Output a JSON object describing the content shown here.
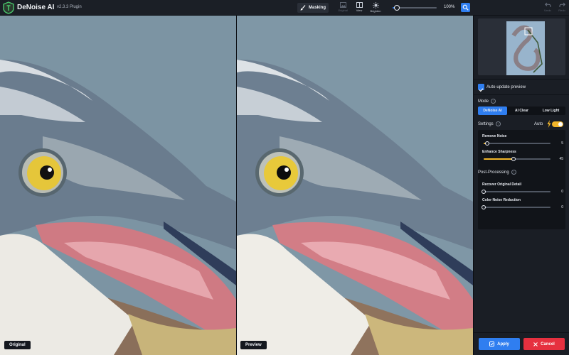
{
  "app": {
    "title": "DeNoise AI",
    "version": "v2.3.3 Plugin"
  },
  "toolbar": {
    "masking_label": "Masking",
    "tools": [
      {
        "label": "Original",
        "icon": "image-icon",
        "enabled": false
      },
      {
        "label": "View",
        "icon": "split-view-icon",
        "enabled": true
      },
      {
        "label": "Brighten",
        "icon": "sun-icon",
        "enabled": true
      }
    ],
    "zoom": {
      "value": 0.1,
      "label": "100%"
    },
    "undo_label": "Undo",
    "redo_label": "Redo"
  },
  "panes": {
    "left_label": "Original",
    "right_label": "Preview"
  },
  "panel": {
    "auto_update": {
      "label": "Auto-update preview",
      "checked": true
    },
    "mode": {
      "title": "Mode",
      "tabs": [
        "DeNoise AI",
        "AI Clear",
        "Low Light"
      ],
      "active": 0
    },
    "settings": {
      "title": "Settings",
      "auto_label": "Auto",
      "auto_on": true,
      "sliders": [
        {
          "name": "Remove Noise",
          "value": "5",
          "fraction": 0.05
        },
        {
          "name": "Enhance Sharpness",
          "value": "45",
          "fraction": 0.45
        }
      ]
    },
    "post_processing": {
      "title": "Post-Processing",
      "sliders": [
        {
          "name": "Recover Original Detail",
          "value": "0",
          "fraction": 0
        },
        {
          "name": "Color Noise Reduction",
          "value": "0",
          "fraction": 0
        }
      ]
    },
    "apply_label": "Apply",
    "cancel_label": "Cancel"
  },
  "colors": {
    "accent": "#2f7ef0",
    "slider": "#f2b62b",
    "cancel": "#e6303f",
    "sky": "#7f97a6"
  }
}
